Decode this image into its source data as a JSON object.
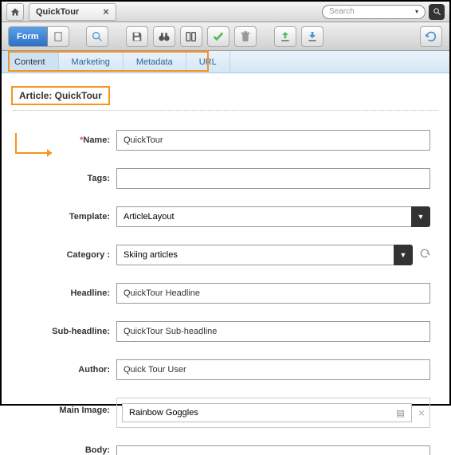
{
  "topbar": {
    "tab_title": "QuickTour",
    "search_placeholder": "Search"
  },
  "toolbar": {
    "form_label": "Form"
  },
  "subtabs": {
    "content": "Content",
    "marketing": "Marketing",
    "metadata": "Metadata",
    "url": "URL"
  },
  "article": {
    "title": "Article: QuickTour"
  },
  "form": {
    "name_label": "Name:",
    "name_value": "QuickTour",
    "tags_label": "Tags:",
    "tags_value": "",
    "template_label": "Template:",
    "template_value": "ArticleLayout",
    "category_label": "Category :",
    "category_value": "Skiing articles",
    "headline_label": "Headline:",
    "headline_value": "QuickTour Headline",
    "subheadline_label": "Sub-headline:",
    "subheadline_value": "QuickTour Sub-headline",
    "author_label": "Author:",
    "author_value": "Quick Tour User",
    "mainimage_label": "Main Image:",
    "mainimage_value": "Rainbow Goggles",
    "body_label": "Body:"
  }
}
